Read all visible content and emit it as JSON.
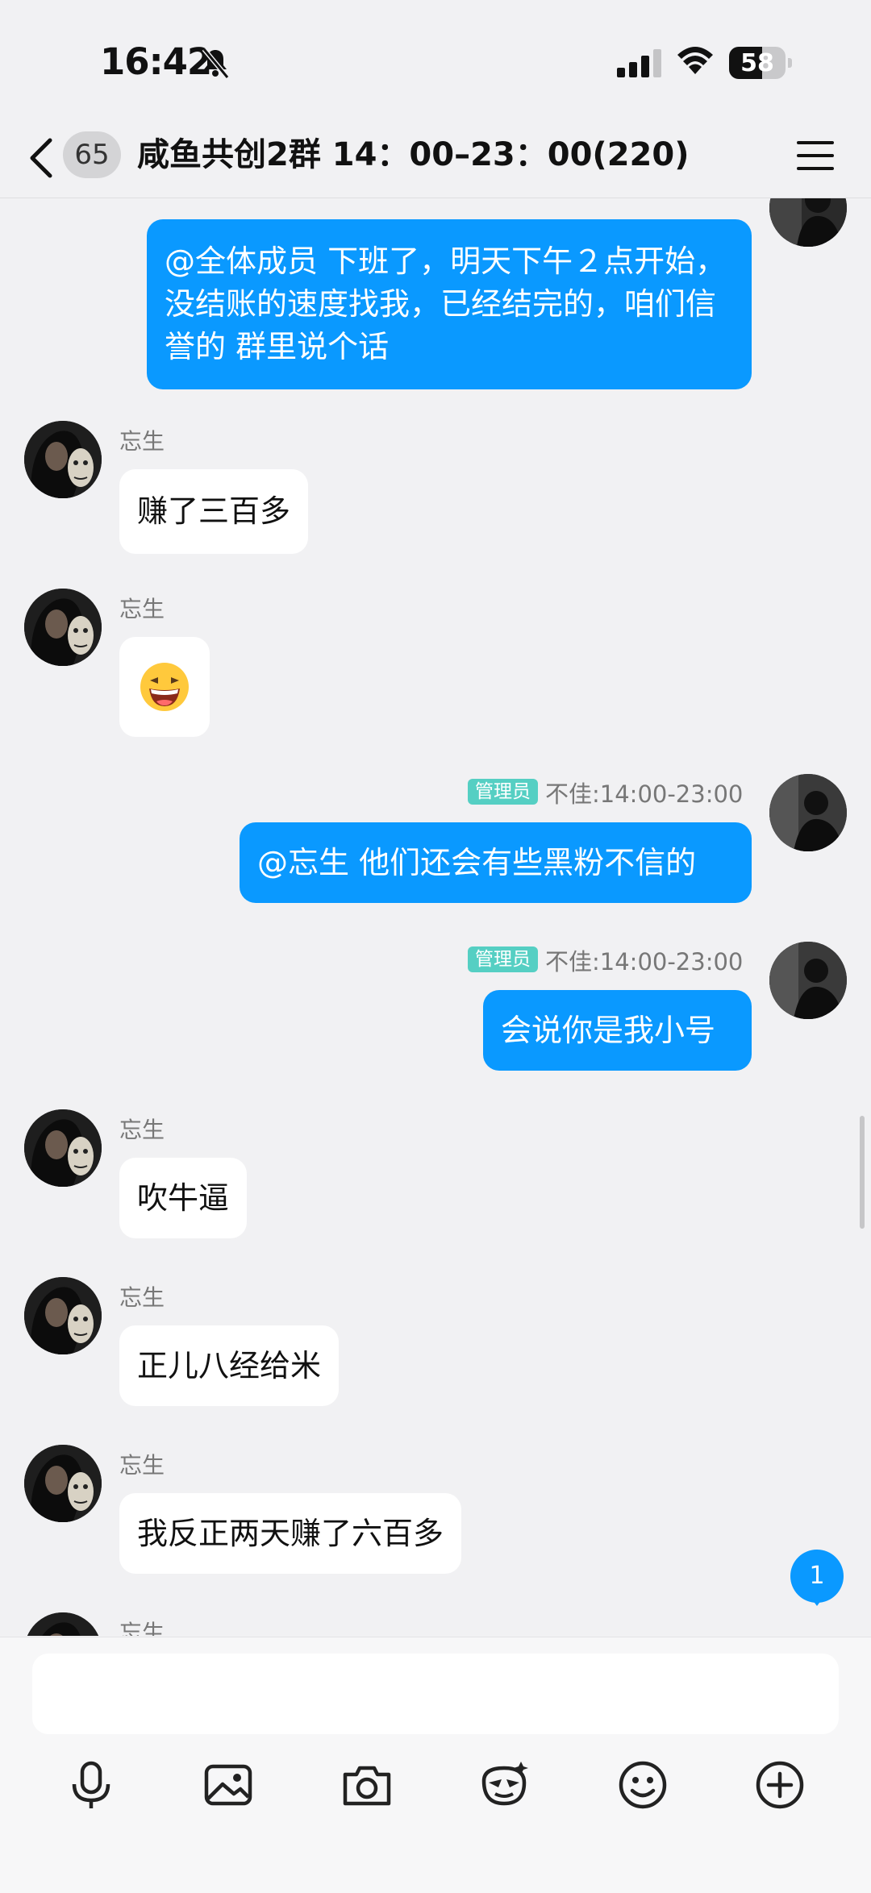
{
  "status_bar": {
    "time": "16:42",
    "battery_level": "58",
    "battery_fill": 0.58
  },
  "header": {
    "unread_count": "65",
    "title": "咸鱼共创2群 14：00–23：00(220)"
  },
  "messages": [
    {
      "side": "right",
      "text": "@全体成员 下班了，明天下午２点开始，没结账的速度找我，已经结完的，咱们信誉的 群里说个话"
    },
    {
      "side": "left",
      "sender": "忘生",
      "text": "赚了三百多"
    },
    {
      "side": "left",
      "sender": "忘生",
      "emoji": "😆"
    },
    {
      "side": "right",
      "role": "管理员",
      "sender": "不佳:14:00-23:00",
      "text": "@忘生 他们还会有些黑粉不信的"
    },
    {
      "side": "right",
      "role": "管理员",
      "sender": "不佳:14:00-23:00",
      "text": "会说你是我小号"
    },
    {
      "side": "left",
      "sender": "忘生",
      "text": "吹牛逼"
    },
    {
      "side": "left",
      "sender": "忘生",
      "text": "正儿八经给米"
    },
    {
      "side": "left",
      "sender": "忘生",
      "text": "我反正两天赚了六百多"
    },
    {
      "side": "left",
      "sender": "忘生"
    }
  ],
  "new_message_badge": "1",
  "composer": {
    "placeholder": "",
    "tools": [
      "microphone-icon",
      "image-icon",
      "camera-icon",
      "sticker-icon",
      "emoji-icon",
      "plus-icon"
    ]
  }
}
